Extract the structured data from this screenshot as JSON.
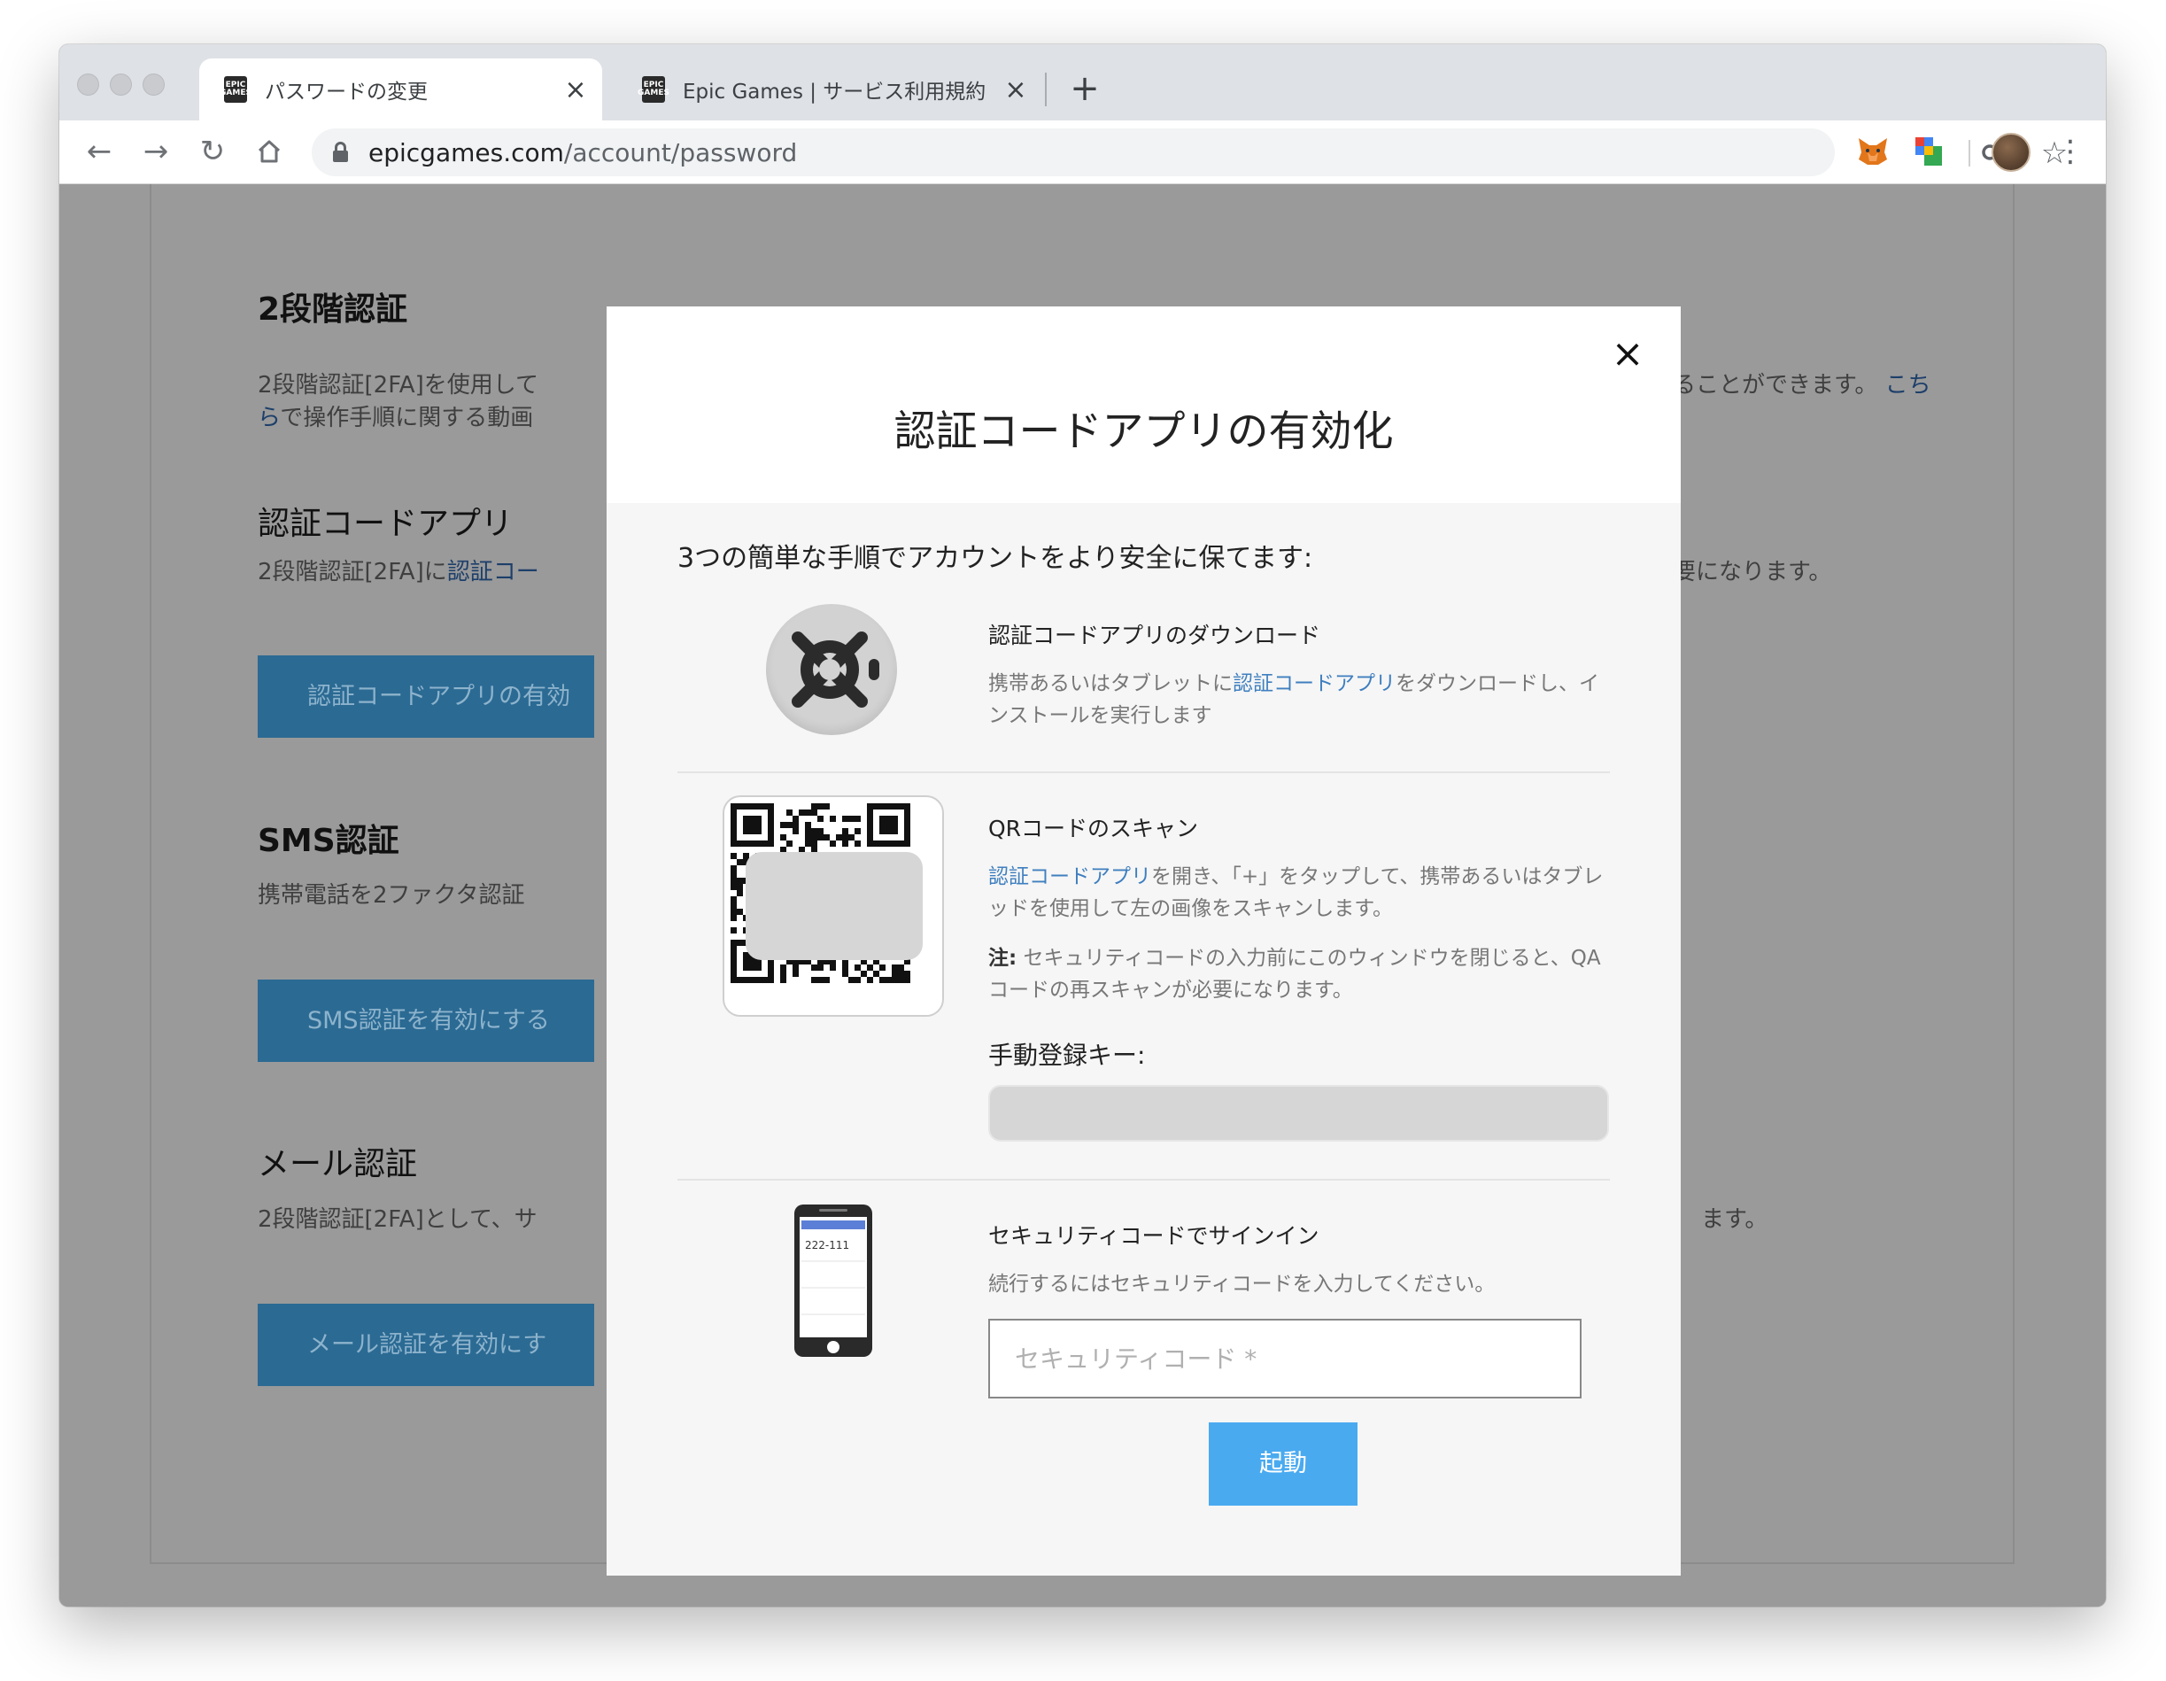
{
  "browser": {
    "tabs": [
      {
        "favicon": "EPIC GAMES",
        "title": "パスワードの変更",
        "close": "×"
      },
      {
        "favicon": "EPIC GAMES",
        "title": "Epic Games | サービス利用規約",
        "close": "×"
      }
    ],
    "new_tab": "+",
    "url_host": "epicgames.com",
    "url_path": "/account/password"
  },
  "background": {
    "heading_2fa": "2段階認証",
    "text_2fa_left": "2段階認証[2FA]を使用して",
    "text_2fa_right": "ることができます。",
    "text_2fa_link_a": "こち",
    "text_2fa_link_b": "ら",
    "text_2fa_line2": "で操作手順に関する動画",
    "heading_app": "認証コードアプリ",
    "text_app_left": "2段階認証[2FA]に",
    "text_app_link": "認証コー",
    "text_app_right": "要になります。",
    "button_app": "認証コードアプリの有効",
    "heading_sms": "SMS認証",
    "text_sms_left": "携帯電話を2ファクタ認証",
    "text_sms_right": "。",
    "button_sms": "SMS認証を有効にする",
    "heading_mail": "メール認証",
    "text_mail_left": "2段階認証[2FA]として、サ",
    "text_mail_right": "ます。",
    "button_mail": "メール認証を有効にす"
  },
  "modal": {
    "close": "×",
    "title": "認証コードアプリの有効化",
    "intro": "3つの簡単な手順でアカウントをより安全に保てます:",
    "step1": {
      "title": "認証コードアプリのダウンロード",
      "desc_a": "携帯あるいはタブレットに",
      "desc_link": "認証コードアプリ",
      "desc_b": "をダウンロードし、インストールを実行します"
    },
    "step2": {
      "title": "QRコードのスキャン",
      "desc_link": "認証コードアプリ",
      "desc_b": "を開き、「+」をタップして、携帯あるいはタブレッドを使用して左の画像をスキャンします。",
      "note_label": "注:",
      "note_text": " セキュリティコードの入力前にこのウィンドウを閉じると、QAコードの再スキャンが必要になります。",
      "manual_key_label": "手動登録キー:"
    },
    "step3": {
      "title": "セキュリティコードでサインイン",
      "desc": "続行するにはセキュリティコードを入力してください。",
      "phone_code": "222-111",
      "input_placeholder": "セキュリティコード *",
      "button": "起動"
    }
  }
}
